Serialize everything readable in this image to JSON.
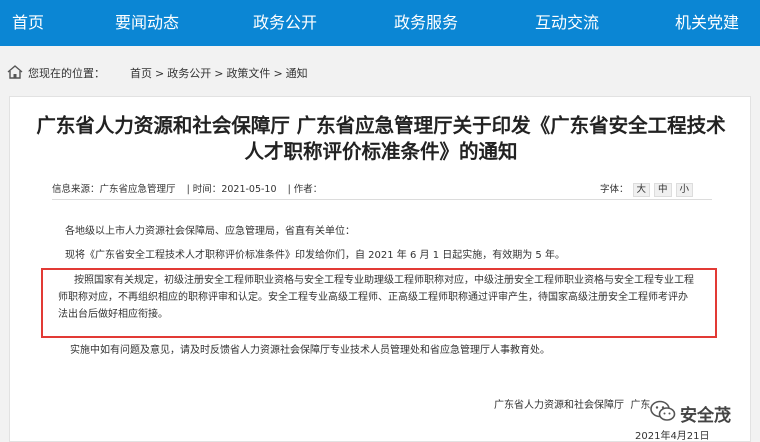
{
  "nav": {
    "items": [
      {
        "label": "首页"
      },
      {
        "label": "要闻动态"
      },
      {
        "label": "政务公开"
      },
      {
        "label": "政务服务"
      },
      {
        "label": "互动交流"
      },
      {
        "label": "机关党建"
      }
    ]
  },
  "breadcrumb": {
    "prefix": "您现在的位置：",
    "items": [
      "首页",
      "政务公开",
      "政策文件",
      "通知"
    ],
    "separator": ">"
  },
  "article": {
    "title": "广东省人力资源和社会保障厅 广东省应急管理厅关于印发《广东省安全工程技术人才职称评价标准条件》的通知",
    "meta": {
      "source_label": "信息来源：",
      "source_value": "广东省应急管理厅",
      "time_label": "时间：",
      "time_value": "2021-05-10",
      "author_label": "作者："
    },
    "font_size": {
      "label": "字体：",
      "options": [
        "大",
        "中",
        "小"
      ]
    },
    "paragraphs": [
      "各地级以上市人力资源社会保障局、应急管理局，省直有关单位：",
      "现将《广东省安全工程技术人才职称评价标准条件》印发给你们，自 2021 年 6 月 1 日起实施，有效期为 5 年。",
      "按照国家有关规定，初级注册安全工程师职业资格与安全工程专业助理级工程师职称对应，中级注册安全工程师职业资格与安全工程专业工程师职称对应，不再组织相应的职称评审和认定。安全工程专业高级工程师、正高级工程师职称通过评审产生，待国家高级注册安全工程师考评办法出台后做好相应衔接。",
      "实施中如有问题及意见，请及时反馈省人力资源社会保障厅专业技术人员管理处和省应急管理厅人事教育处。"
    ],
    "signature": {
      "org": "广东省人力资源和社会保障厅",
      "org2_partial": "广东",
      "date": "2021年4月21日"
    }
  },
  "watermark": {
    "text": "安全茂",
    "icon": "wechat-icon"
  },
  "colors": {
    "nav_bg": "#0b86d4",
    "highlight_border": "#e23a35",
    "page_bg": "#f2f2f2"
  }
}
